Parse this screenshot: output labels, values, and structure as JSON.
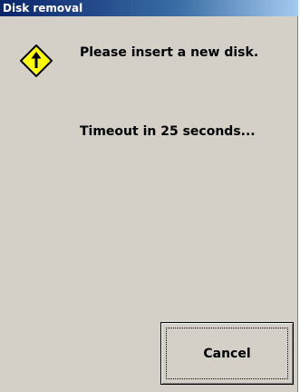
{
  "window": {
    "title": "Disk removal"
  },
  "dialog": {
    "icon": "warning-arrow-up-icon",
    "message": "Please insert a new disk.",
    "timeout_text": "Timeout in 25 seconds..."
  },
  "buttons": {
    "cancel_label": "Cancel"
  },
  "colors": {
    "title_bar": "#0a246a",
    "dialog_background": "#d4d0c8",
    "warning_fill": "#ffff00"
  }
}
